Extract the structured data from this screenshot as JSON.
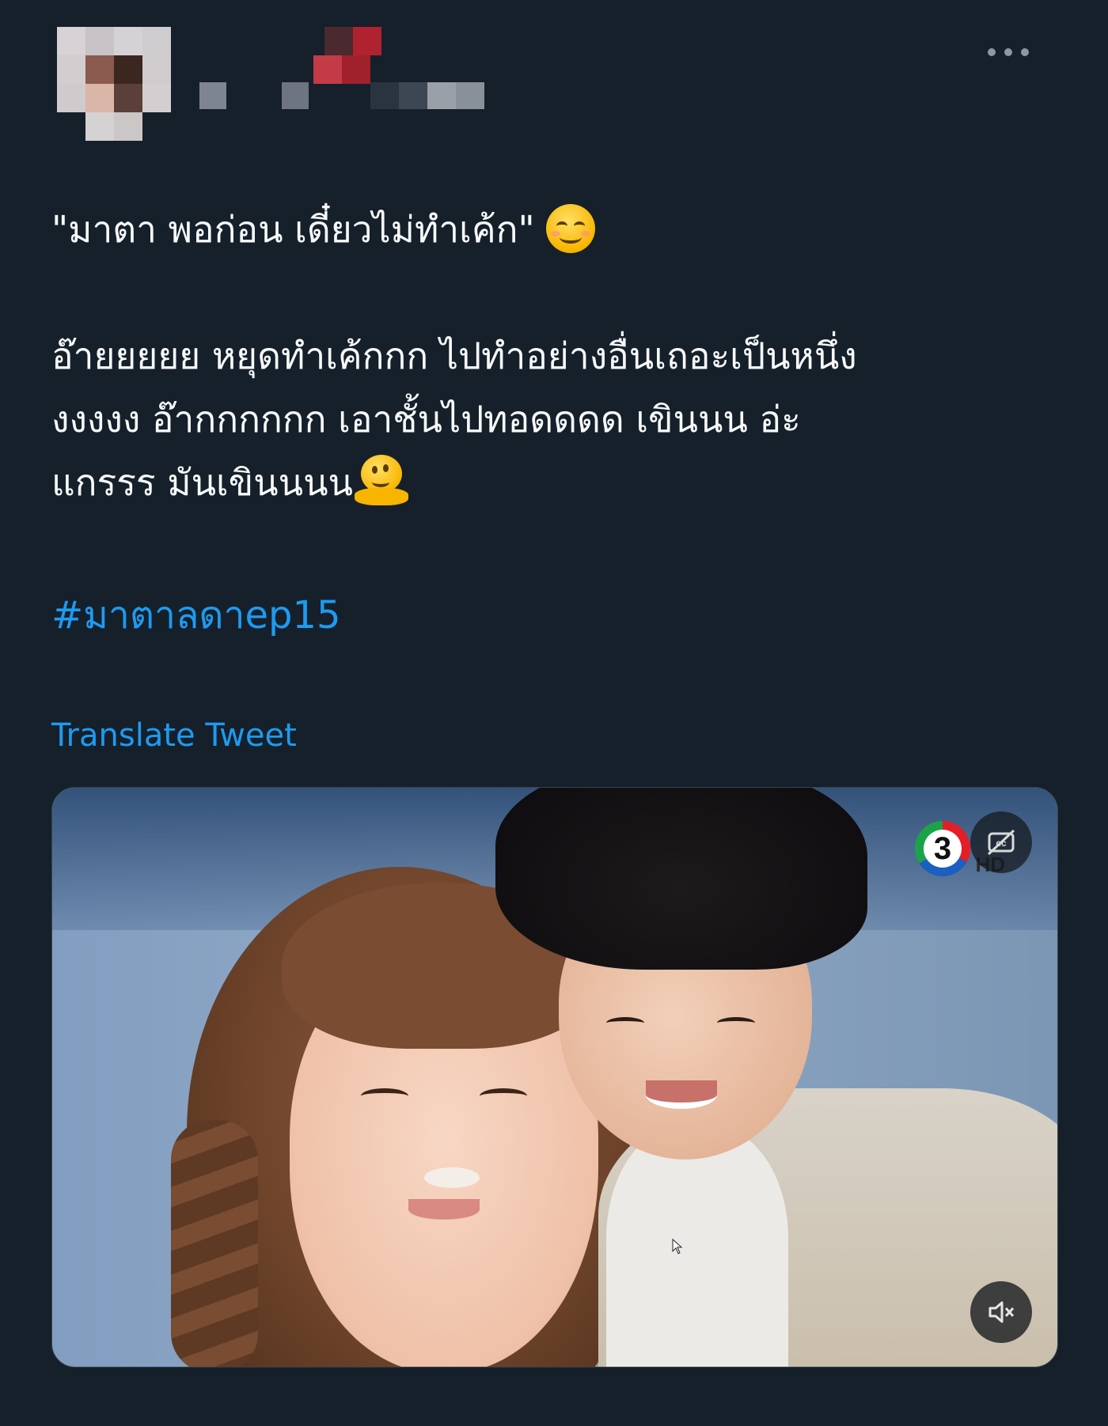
{
  "tweet": {
    "author": {
      "avatar_pixels": [
        [
          "#d6d2d5",
          "#c7c3c6",
          "#d4d2d4",
          "#cfcccf"
        ],
        [
          "#d2cdcf",
          "#8a5b4e",
          "#3b2620",
          "#d0ccce"
        ],
        [
          "#cfcbcd",
          "#d9b6a8",
          "#5b4039",
          "#d3cfd1"
        ],
        [
          "#15202b",
          "#d5d2d3",
          "#cac7c6",
          "#15202b"
        ]
      ],
      "name_pixel_colors": [
        "#d0393f",
        "#4a2a2f",
        "#b02230",
        "#c33b47",
        "#9a9fa8",
        "#7f8590",
        "#2a3440",
        "#3d4754"
      ]
    },
    "text": {
      "quote_line": "\"มาตา พอก่อน เดี๋ยวไม่ทำเค้ก\"",
      "body": "อ๊ายยยยย หยุดทำเค้กกก ไปทำอย่างอื่นเถอะเป็นหนึ่ง\nงงงงง อ๊ากกกกกก เอาชั้นไปทอดดดด เขินนน อ่ะ\nแกรรร มันเขินนนน"
    },
    "emojis": {
      "quote_emoji": "smiling-face-with-smiling-eyes",
      "body_emoji": "melting-face"
    },
    "hashtag": "#มาตาลดาep15",
    "translate_label": "Translate Tweet",
    "media": {
      "type": "video",
      "channel_logo_text": "3",
      "channel_hd_text": "HD",
      "captions_icon": "captions-off-icon",
      "mute_icon": "speaker-muted-icon"
    }
  },
  "colors": {
    "background": "#15202b",
    "text": "#f7f9f9",
    "link": "#1d9bf0",
    "muted": "#8b98a5"
  }
}
